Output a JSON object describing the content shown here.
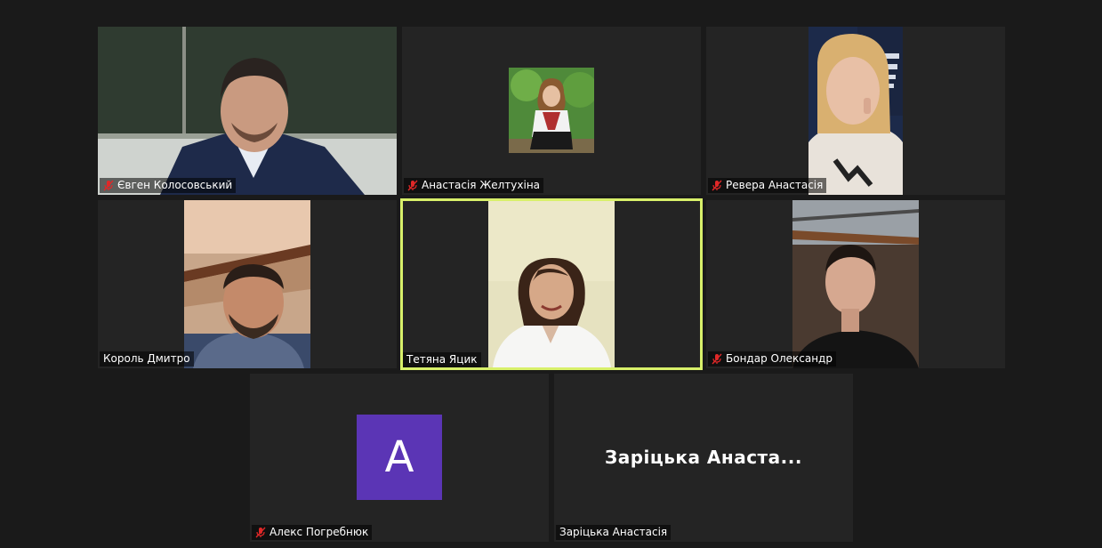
{
  "participants": [
    {
      "name": "Євген Колосовський",
      "muted": true
    },
    {
      "name": "Анастасія Желтухіна",
      "muted": true
    },
    {
      "name": "Ревера Анастасія",
      "muted": true
    },
    {
      "name": "Король Дмитро",
      "muted": false
    },
    {
      "name": "Тетяна Яцик",
      "muted": false,
      "active_speaker": true
    },
    {
      "name": "Бондар Олександр",
      "muted": true
    },
    {
      "name": "Алекс Погребнюк",
      "muted": true,
      "avatar_letter": "A",
      "avatar_color": "#5b35b5"
    },
    {
      "name": "Заріцька Анастасія",
      "muted": false,
      "display_name_large": "Заріцька  Анаста..."
    }
  ],
  "colors": {
    "background": "#1a1a1a",
    "tile": "#242424",
    "active_border": "#d8f06a",
    "muted_icon": "#e02828"
  }
}
